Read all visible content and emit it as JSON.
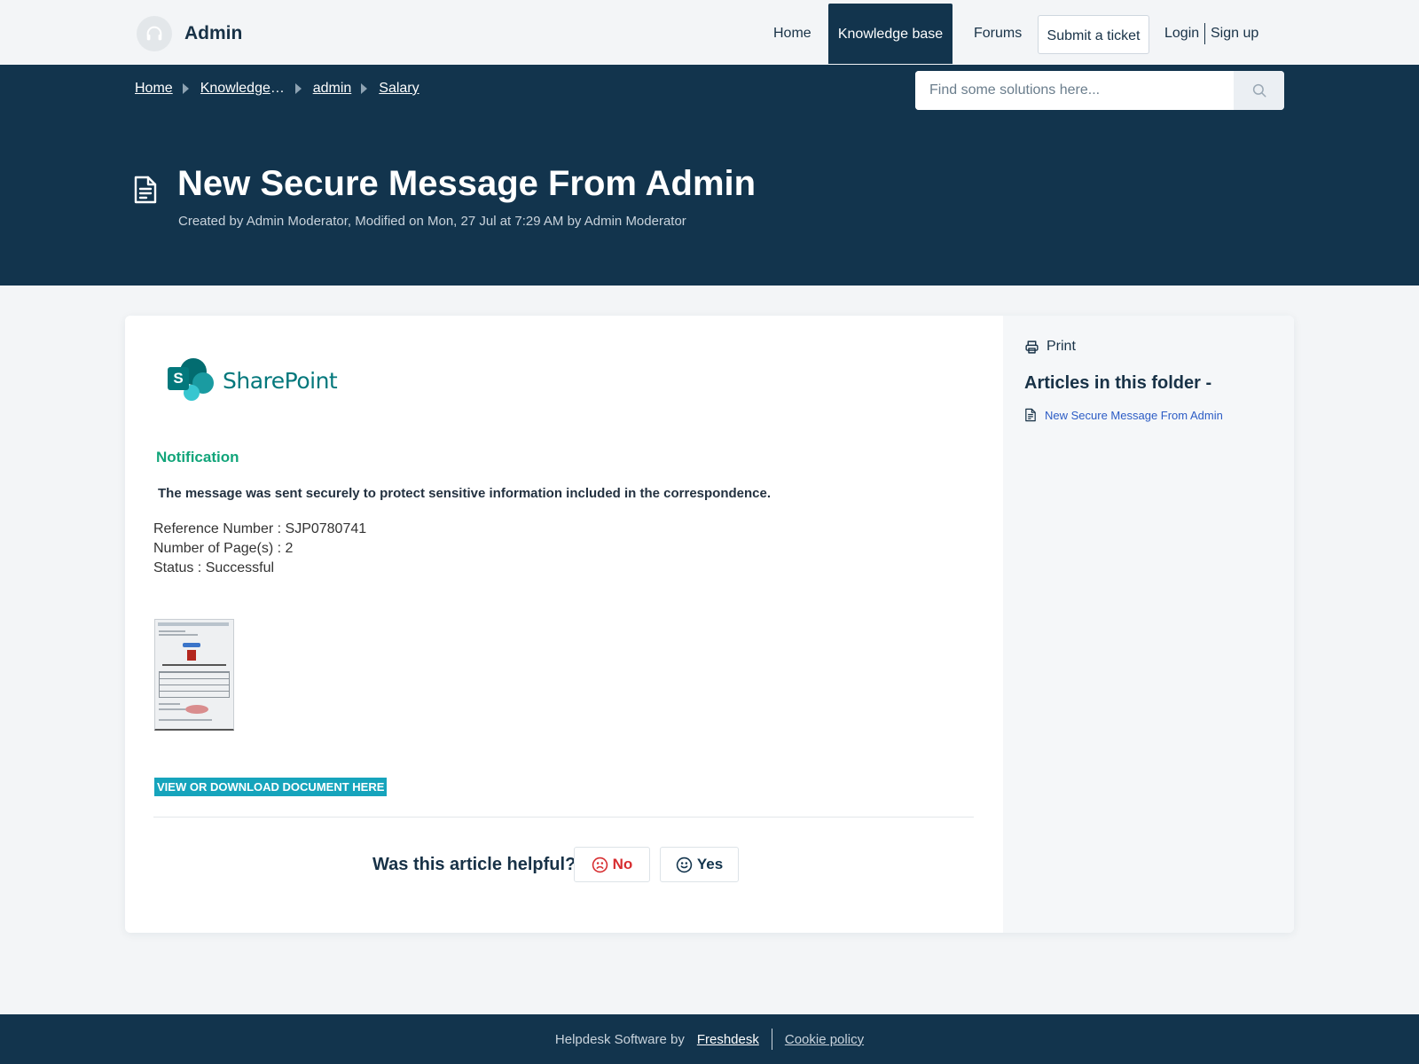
{
  "header": {
    "brand_name": "Admin",
    "brand_icon": "headset-icon",
    "nav": {
      "home": "Home",
      "knowledge_base": "Knowledge base",
      "forums": "Forums",
      "submit_ticket": "Submit a ticket",
      "login": "Login",
      "signup": "Sign up"
    },
    "active_nav": "knowledge_base"
  },
  "breadcrumb": [
    "Home",
    "Knowledge base",
    "admin",
    "Salary"
  ],
  "search": {
    "placeholder": "Find some solutions here...",
    "icon": "search-icon"
  },
  "article": {
    "title": "New Secure Message From Admin",
    "meta": "Created by Admin Moderator, Modified on Mon, 27 Jul at 7:29 AM by Admin Moderator",
    "logo_text": "SharePoint",
    "logo_letter": "S",
    "notification_heading": "Notification",
    "lead_text": "The message was sent securely to protect sensitive information included in the correspondence.",
    "details": [
      {
        "label": "Reference Number",
        "value": "SJP0780741"
      },
      {
        "label": "Number of Page(s)",
        "value": "2"
      },
      {
        "label": "Status",
        "value": "Successful"
      }
    ],
    "download_label": "VIEW OR DOWNLOAD DOCUMENT HERE"
  },
  "feedback": {
    "question": "Was this article helpful?",
    "no_label": "No",
    "yes_label": "Yes"
  },
  "sidebar": {
    "print_label": "Print",
    "folder_title": "Articles in this folder -",
    "articles": [
      "New Secure Message From Admin"
    ]
  },
  "footer": {
    "text": "Helpdesk Software by",
    "link": "Freshdesk",
    "cookie": "Cookie policy"
  },
  "colors": {
    "primary_dark": "#12344d",
    "accent_green": "#12a57a",
    "download_button": "#16a4bc",
    "link_blue": "#2c5cc5",
    "no_red": "#d72d30"
  }
}
